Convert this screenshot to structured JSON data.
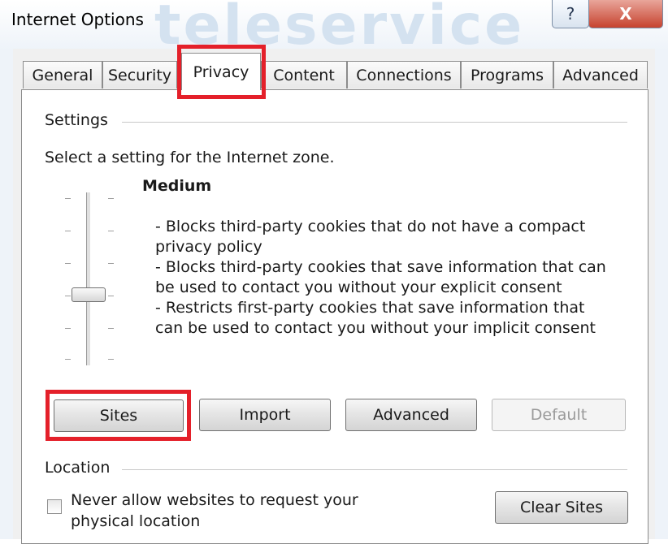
{
  "window": {
    "title": "Internet Options",
    "watermark": "teleservice",
    "help_glyph": "?",
    "close_glyph": "X"
  },
  "tabs": [
    {
      "label": "General"
    },
    {
      "label": "Security"
    },
    {
      "label": "Privacy",
      "active": true
    },
    {
      "label": "Content"
    },
    {
      "label": "Connections"
    },
    {
      "label": "Programs"
    },
    {
      "label": "Advanced"
    }
  ],
  "settings": {
    "group_label": "Settings",
    "instruction": "Select a setting for the Internet zone.",
    "level_name": "Medium",
    "slider_level": "Medium",
    "description_lines": [
      "- Blocks third-party cookies that do not have a compact",
      "privacy policy",
      "- Blocks third-party cookies that save information that can",
      "be used to contact you without your explicit consent",
      "- Restricts first-party cookies that save information that",
      "can be used to contact you without your implicit consent"
    ],
    "buttons": {
      "sites": "Sites",
      "import": "Import",
      "advanced": "Advanced",
      "default": "Default"
    }
  },
  "location": {
    "group_label": "Location",
    "checkbox_label_line1": "Never allow websites to request your",
    "checkbox_label_line2": "physical location",
    "checkbox_checked": false,
    "clear_sites": "Clear Sites"
  },
  "colors": {
    "highlight": "#e4202a"
  }
}
